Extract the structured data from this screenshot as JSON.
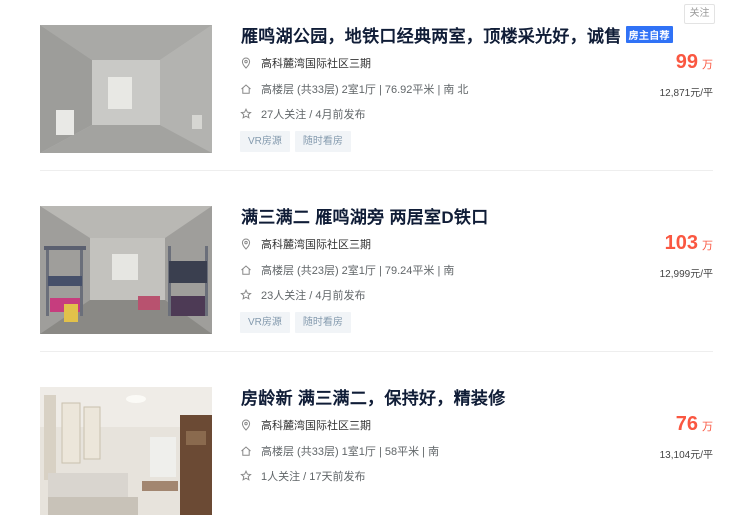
{
  "follow_label": "关注",
  "listings": [
    {
      "title": "雁鸣湖公园，地铁口经典两室，顶楼采光好，诚售",
      "owner_tag": "房主自荐",
      "community": "高科麓湾国际社区三期",
      "house_info": "高楼层 (共33层) 2室1厅 | 76.92平米 | 南 北",
      "follow_info": "27人关注 / 4月前发布",
      "tags": [
        "VR房源",
        "随时看房"
      ],
      "price": "99",
      "price_unit": "万",
      "unit_price": "12,871元/平"
    },
    {
      "title": "满三满二 雁鸣湖旁 两居室D铁口",
      "community": "高科麓湾国际社区三期",
      "house_info": "高楼层 (共23层) 2室1厅 | 79.24平米 | 南",
      "follow_info": "23人关注 / 4月前发布",
      "tags": [
        "VR房源",
        "随时看房"
      ],
      "price": "103",
      "price_unit": "万",
      "unit_price": "12,999元/平"
    },
    {
      "title": "房龄新 满三满二，保持好，精装修",
      "community": "高科麓湾国际社区三期",
      "house_info": "高楼层 (共33层) 1室1厅 | 58平米 | 南",
      "follow_info": "1人关注 / 17天前发布",
      "price": "76",
      "price_unit": "万",
      "unit_price": "13,104元/平"
    }
  ],
  "icons": {
    "location": "location-pin-icon",
    "house": "house-icon",
    "star": "star-icon"
  },
  "colors": {
    "price": "#fa5741",
    "owner_tag": "#3072f6",
    "title": "#101d37"
  }
}
